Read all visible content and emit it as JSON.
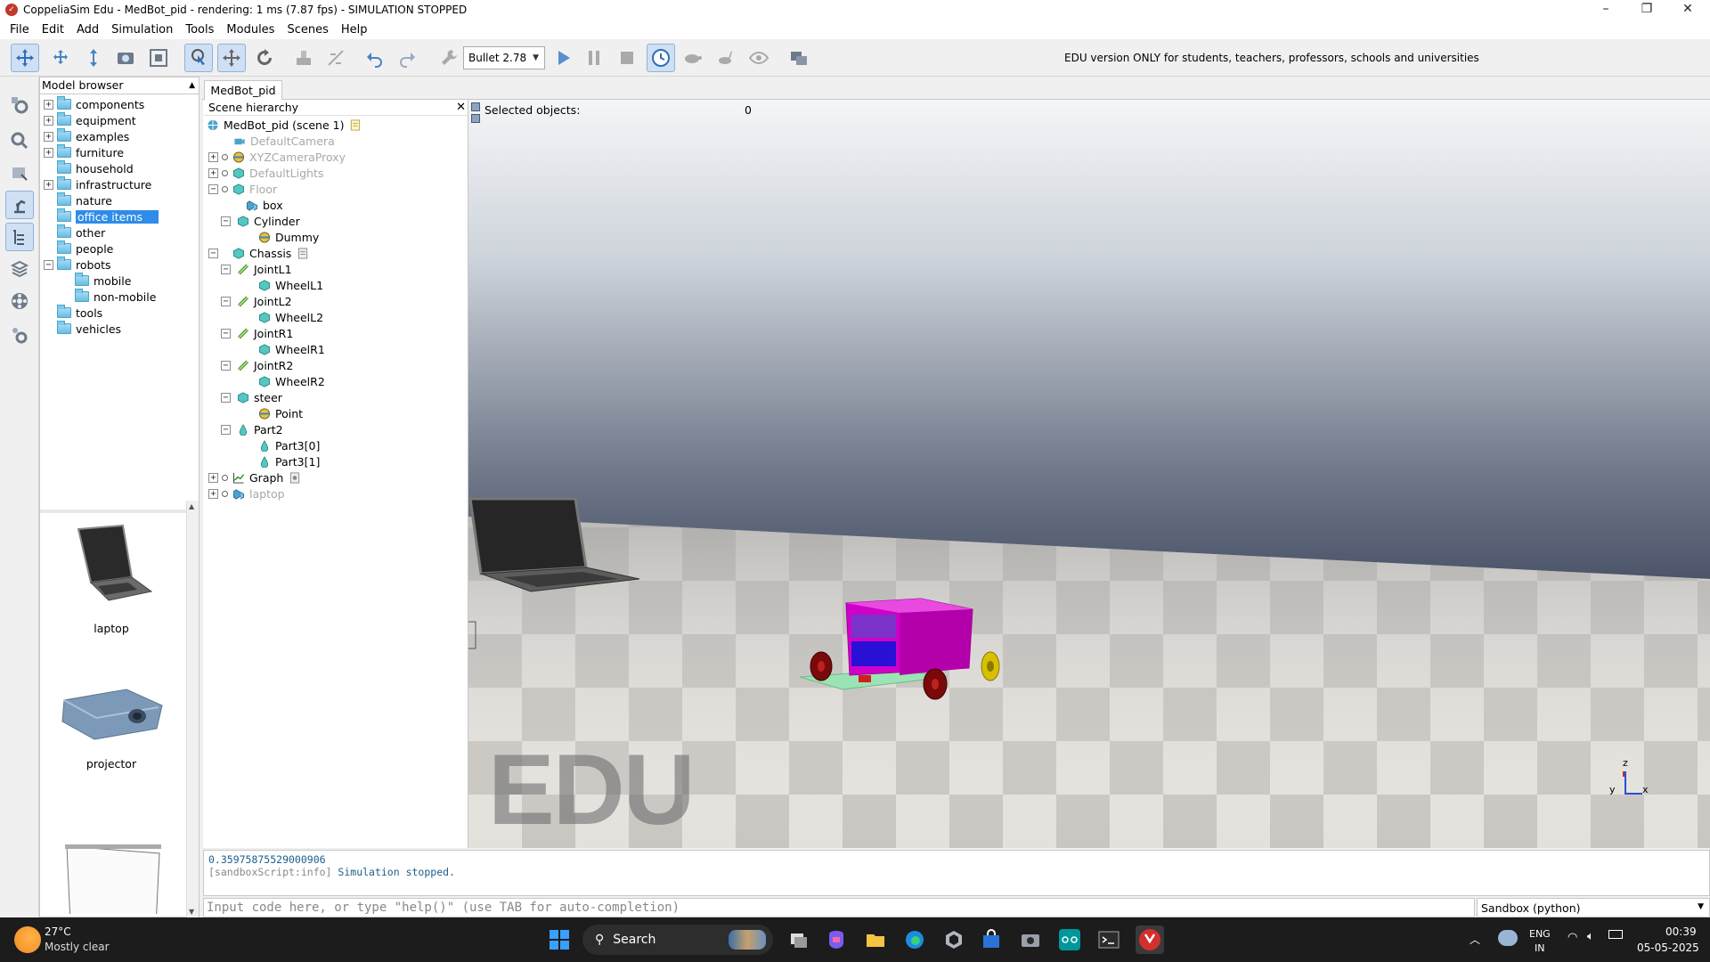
{
  "window": {
    "title": "CoppeliaSim Edu - MedBot_pid - rendering: 1 ms (7.87 fps) - SIMULATION STOPPED",
    "minimize": "–",
    "maximize": "❐",
    "close": "✕"
  },
  "menu": [
    "File",
    "Edit",
    "Add",
    "Simulation",
    "Tools",
    "Modules",
    "Scenes",
    "Help"
  ],
  "toolbar": {
    "engine": "Bullet 2.78",
    "edu_notice": "EDU version ONLY for students, teachers, professors, schools and universities"
  },
  "model_browser": {
    "title": "Model browser",
    "folders": [
      {
        "label": "components",
        "expander": "+"
      },
      {
        "label": "equipment",
        "expander": "+"
      },
      {
        "label": "examples",
        "expander": "+"
      },
      {
        "label": "furniture",
        "expander": "+"
      },
      {
        "label": "household",
        "expander": ""
      },
      {
        "label": "infrastructure",
        "expander": "+"
      },
      {
        "label": "nature",
        "expander": ""
      },
      {
        "label": "office items",
        "expander": "",
        "selected": true
      },
      {
        "label": "other",
        "expander": ""
      },
      {
        "label": "people",
        "expander": ""
      },
      {
        "label": "robots",
        "expander": "−"
      },
      {
        "label": "mobile",
        "expander": "",
        "child": true
      },
      {
        "label": "non-mobile",
        "expander": "",
        "child": true
      },
      {
        "label": "tools",
        "expander": ""
      },
      {
        "label": "vehicles",
        "expander": ""
      }
    ],
    "thumbnails": [
      "laptop",
      "projector",
      ""
    ]
  },
  "scene": {
    "tab": "MedBot_pid",
    "hierarchy_title": "Scene hierarchy",
    "close": "✕",
    "root": "MedBot_pid (scene 1)",
    "items": [
      {
        "label": "DefaultCamera",
        "dim": true
      },
      {
        "label": "XYZCameraProxy",
        "dim": true
      },
      {
        "label": "DefaultLights",
        "dim": true
      },
      {
        "label": "Floor",
        "dim": true
      },
      {
        "label": "box"
      },
      {
        "label": "Cylinder"
      },
      {
        "label": "Dummy"
      },
      {
        "label": "Chassis"
      },
      {
        "label": "JointL1"
      },
      {
        "label": "WheelL1"
      },
      {
        "label": "JointL2"
      },
      {
        "label": "WheelL2"
      },
      {
        "label": "JointR1"
      },
      {
        "label": "WheelR1"
      },
      {
        "label": "JointR2"
      },
      {
        "label": "WheelR2"
      },
      {
        "label": "steer"
      },
      {
        "label": "Point"
      },
      {
        "label": "Part2"
      },
      {
        "label": "Part3[0]"
      },
      {
        "label": "Part3[1]"
      },
      {
        "label": "Graph"
      },
      {
        "label": "laptop",
        "dim": true
      }
    ],
    "selected_label": "Selected objects:",
    "selected_count": "0",
    "watermark": "EDU",
    "axis_x": "x",
    "axis_y": "y",
    "axis_z": "z"
  },
  "console": {
    "line1": "0.35975875529000906",
    "line2_tag": "[sandboxScript:info]",
    "line2_msg": "Simulation stopped.",
    "input_placeholder": "Input code here, or type \"help()\" (use TAB for auto-completion)",
    "sandbox": "Sandbox (python)"
  },
  "taskbar": {
    "temp": "27°C",
    "weather": "Mostly clear",
    "search": "Search",
    "lang1": "ENG",
    "lang2": "IN",
    "time": "00:39",
    "date": "05-05-2025"
  }
}
